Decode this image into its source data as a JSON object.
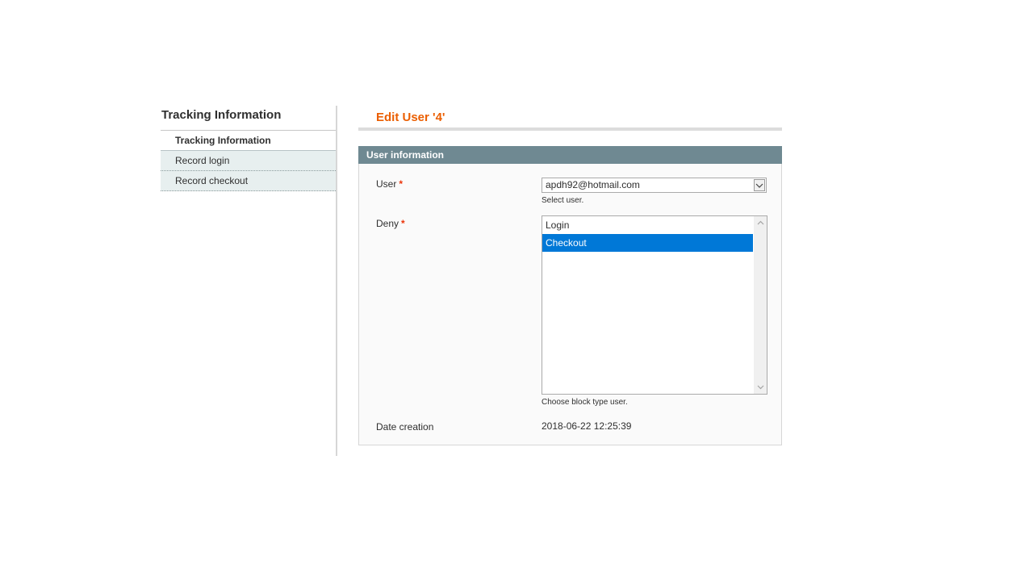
{
  "sidebar": {
    "title": "Tracking Information",
    "items": [
      {
        "label": "Tracking Information"
      },
      {
        "label": "Record login"
      },
      {
        "label": "Record checkout"
      }
    ]
  },
  "page": {
    "title": "Edit User '4'"
  },
  "fieldset": {
    "title": "User information",
    "user": {
      "label": "User",
      "required_mark": "*",
      "value": "apdh92@hotmail.com",
      "note": "Select user."
    },
    "deny": {
      "label": "Deny",
      "required_mark": "*",
      "options": [
        {
          "label": "Login",
          "selected": false
        },
        {
          "label": "Checkout",
          "selected": true
        }
      ],
      "note": "Choose block type user."
    },
    "date_creation": {
      "label": "Date creation",
      "value": "2018-06-22 12:25:39"
    }
  },
  "icons": {
    "select_arrow": "chevron-down-icon",
    "scroll_up": "scroll-up-arrow-icon",
    "scroll_down": "scroll-down-arrow-icon"
  },
  "colors": {
    "title_accent": "#eb5e00",
    "fieldset_header": "#6f8992",
    "selected_option": "#0078d7",
    "required": "#eb340a",
    "sidebar_item_bg": "#e7efef"
  }
}
